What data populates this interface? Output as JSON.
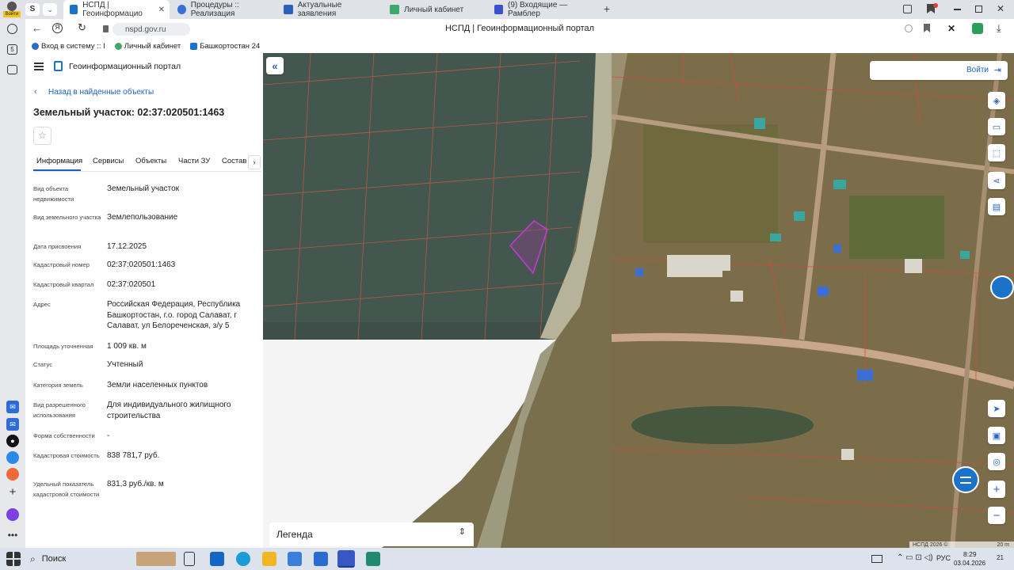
{
  "browser": {
    "tabs": [
      {
        "label": "НСПД | Геоинформацио",
        "color": "#1a73c8",
        "active": true
      },
      {
        "label": "Процедуры :: Реализация",
        "color": "#3a6fd8"
      },
      {
        "label": "Актуальные заявления",
        "color": "#2b5fb8"
      },
      {
        "label": "Личный кабинет",
        "color": "#3fa86b"
      },
      {
        "label": "(9) Входящие — Рамблер",
        "color": "#3c4fcf"
      }
    ],
    "corner_badge": "Войти",
    "url": "nspd.gov.ru",
    "page_title": "НСПД | Геоинформационный портал",
    "bookmarks": [
      {
        "label": "Вход в систему :: I",
        "color": "#2e68c9"
      },
      {
        "label": "Личный кабинет",
        "color": "#3fa86b"
      },
      {
        "label": "Башкортостан 24",
        "color": "#1a73c8"
      }
    ],
    "badge_count": "5"
  },
  "panel": {
    "portal_title": "Геоинформационный портал",
    "back_link": "Назад в найденные объекты",
    "object_title": "Земельный участок: 02:37:020501:1463",
    "tabs": [
      "Информация",
      "Сервисы",
      "Объекты",
      "Части ЗУ",
      "Состав"
    ],
    "active_tab": "Информация",
    "fields": [
      {
        "label": "Вид объекта недвижимости",
        "value": "Земельный участок"
      },
      {
        "label": "Вид земельного участка",
        "value": "Землепользование"
      },
      {
        "label": "Дата присвоения",
        "value": "17.12.2025"
      },
      {
        "label": "Кадастровый номер",
        "value": "02:37:020501:1463"
      },
      {
        "label": "Кадастровый квартал",
        "value": "02:37:020501"
      },
      {
        "label": "Адрес",
        "value": "Российская Федерация, Республика Башкортостан, г.о. город Салават, г Салават, ул Белореченская, з/у 5"
      },
      {
        "label": "Площадь уточненная",
        "value": "1 009 кв. м"
      },
      {
        "label": "Статус",
        "value": "Учтенный"
      },
      {
        "label": "Категория земель",
        "value": "Земли населенных пунктов"
      },
      {
        "label": "Вид разрешенного использования",
        "value": "Для индивидуального жилищного строительства"
      },
      {
        "label": "Форма собственности",
        "value": "-"
      },
      {
        "label": "Кадастровая стоимость",
        "value": "838 781,7 руб."
      },
      {
        "label": "Удельный показатель кадастровой стоимости",
        "value": "831,3 руб./кв. м"
      }
    ]
  },
  "map": {
    "login_label": "Войти",
    "legend_label": "Легенда",
    "attribution": "НСПД 2026 ©",
    "scale_label": "20 m"
  },
  "taskbar": {
    "search_label": "Поиск",
    "lang": "РУС",
    "time": "8:29",
    "date": "03.04.2026",
    "notif": "21"
  }
}
